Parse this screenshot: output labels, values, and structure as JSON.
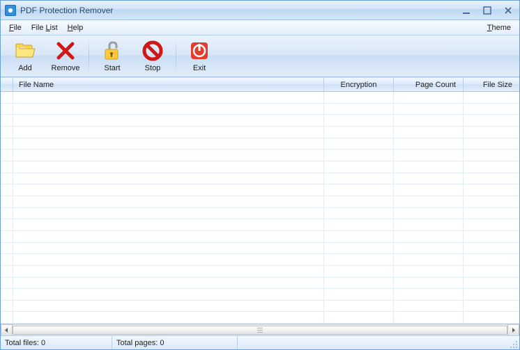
{
  "window": {
    "title": "PDF Protection Remover"
  },
  "menu": {
    "file": "File",
    "filelist": "File List",
    "help": "Help",
    "theme": "Theme"
  },
  "toolbar": {
    "add": "Add",
    "remove": "Remove",
    "start": "Start",
    "stop": "Stop",
    "exit": "Exit"
  },
  "table": {
    "headers": {
      "filename": "File Name",
      "encryption": "Encryption",
      "pagecount": "Page Count",
      "filesize": "File Size"
    }
  },
  "status": {
    "total_files": "Total files: 0",
    "total_pages": "Total pages: 0"
  }
}
